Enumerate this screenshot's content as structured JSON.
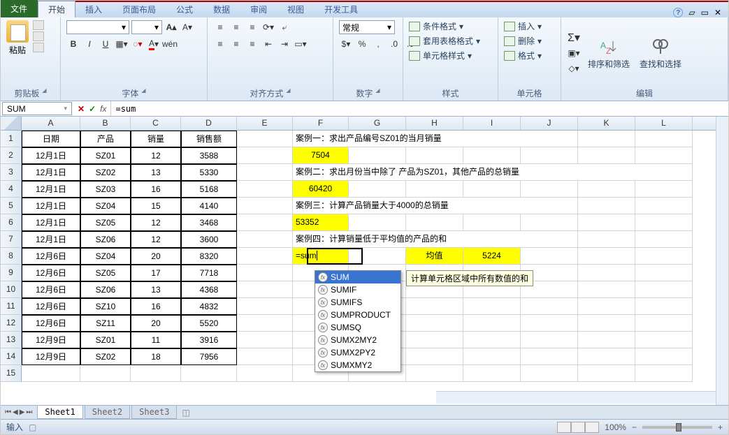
{
  "tabs": {
    "file": "文件",
    "home": "开始",
    "insert": "插入",
    "layout": "页面布局",
    "formula": "公式",
    "data": "数据",
    "review": "审阅",
    "view": "视图",
    "dev": "开发工具"
  },
  "ribbon": {
    "clipboard": {
      "paste": "粘贴",
      "label": "剪贴板"
    },
    "font": {
      "label": "字体",
      "size_up": "A",
      "size_down": "A"
    },
    "align": {
      "label": "对齐方式"
    },
    "number": {
      "label": "数字",
      "general": "常规"
    },
    "styles": {
      "cond": "条件格式",
      "table": "套用表格格式",
      "cell": "单元格样式",
      "label": "样式"
    },
    "cells": {
      "insert": "插入",
      "delete": "删除",
      "format": "格式",
      "label": "单元格"
    },
    "editing": {
      "sort": "排序和筛选",
      "find": "查找和选择",
      "label": "编辑"
    }
  },
  "formula_bar": {
    "name": "SUM",
    "value": "=sum"
  },
  "columns": [
    "A",
    "B",
    "C",
    "D",
    "E",
    "F",
    "G",
    "H",
    "I",
    "J",
    "K",
    "L"
  ],
  "headers": {
    "date": "日期",
    "product": "产品",
    "qty": "销量",
    "amount": "销售额"
  },
  "rows": [
    {
      "n": 1
    },
    {
      "n": 2,
      "date": "12月1日",
      "product": "SZ01",
      "qty": "12",
      "amount": "3588"
    },
    {
      "n": 3,
      "date": "12月1日",
      "product": "SZ02",
      "qty": "13",
      "amount": "5330"
    },
    {
      "n": 4,
      "date": "12月1日",
      "product": "SZ03",
      "qty": "16",
      "amount": "5168"
    },
    {
      "n": 5,
      "date": "12月1日",
      "product": "SZ04",
      "qty": "15",
      "amount": "4140"
    },
    {
      "n": 6,
      "date": "12月1日",
      "product": "SZ05",
      "qty": "12",
      "amount": "3468"
    },
    {
      "n": 7,
      "date": "12月1日",
      "product": "SZ06",
      "qty": "12",
      "amount": "3600"
    },
    {
      "n": 8,
      "date": "12月6日",
      "product": "SZ04",
      "qty": "20",
      "amount": "8320"
    },
    {
      "n": 9,
      "date": "12月6日",
      "product": "SZ05",
      "qty": "17",
      "amount": "7718"
    },
    {
      "n": 10,
      "date": "12月6日",
      "product": "SZ06",
      "qty": "13",
      "amount": "4368"
    },
    {
      "n": 11,
      "date": "12月6日",
      "product": "SZ10",
      "qty": "16",
      "amount": "4832"
    },
    {
      "n": 12,
      "date": "12月6日",
      "product": "SZ11",
      "qty": "20",
      "amount": "5520"
    },
    {
      "n": 13,
      "date": "12月9日",
      "product": "SZ01",
      "qty": "11",
      "amount": "3916"
    },
    {
      "n": 14,
      "date": "12月9日",
      "product": "SZ02",
      "qty": "18",
      "amount": "7956"
    },
    {
      "n": 15
    }
  ],
  "cases": {
    "c1": "案例一：求出产品编号SZ01的当月销量",
    "v1": "7504",
    "c2": "案例二：求出月份当中除了 产品为SZ01，其他产品的总销量",
    "v2": "60420",
    "c3": "案例三：计算产品销量大于4000的总销量",
    "v3": "53352",
    "c4": "案例四：计算销量低于平均值的产品的和",
    "editing": "=sum",
    "avg_label": "均值",
    "avg_val": "5224"
  },
  "dropdown": [
    "SUM",
    "SUMIF",
    "SUMIFS",
    "SUMPRODUCT",
    "SUMSQ",
    "SUMX2MY2",
    "SUMX2PY2",
    "SUMXMY2"
  ],
  "tooltip": "计算单元格区域中所有数值的和",
  "sheets": [
    "Sheet1",
    "Sheet2",
    "Sheet3"
  ],
  "status": {
    "mode": "输入",
    "zoom": "100%"
  }
}
